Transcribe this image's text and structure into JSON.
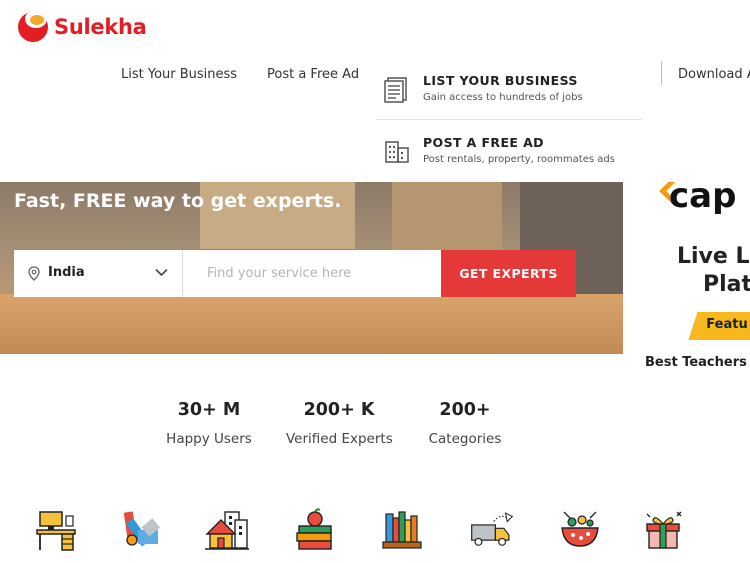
{
  "brand": {
    "name": "Sulekha",
    "accent": "#e21d24",
    "secondary": "#f5a623"
  },
  "nav": {
    "list_business": "List Your Business",
    "post_ad": "Post a Free Ad",
    "download": "Download A"
  },
  "dropdown": [
    {
      "title": "LIST YOUR BUSINESS",
      "subtitle": "Gain access to hundreds of jobs",
      "icon": "document-list-icon"
    },
    {
      "title": "POST A FREE AD",
      "subtitle": "Post rentals, property, roommates ads",
      "icon": "building-icon"
    }
  ],
  "hero": {
    "title": "Fast, FREE way to get experts.",
    "location": "India",
    "search_placeholder": "Find your service here",
    "cta": "GET EXPERTS",
    "cta_color": "#e53838"
  },
  "ad": {
    "logo": "cap",
    "line1": "Live Le",
    "line2": "Plat",
    "badge": "Featu",
    "tagline": "Best Teachers"
  },
  "stats": [
    {
      "value": "30+ M",
      "label": "Happy Users"
    },
    {
      "value": "200+ K",
      "label": "Verified Experts"
    },
    {
      "value": "200+",
      "label": "Categories"
    }
  ],
  "categories": [
    {
      "icon": "office-desk-icon"
    },
    {
      "icon": "paint-swatch-icon"
    },
    {
      "icon": "home-buildings-icon"
    },
    {
      "icon": "books-apple-icon"
    },
    {
      "icon": "bookshelf-icon"
    },
    {
      "icon": "moving-truck-icon"
    },
    {
      "icon": "food-bowl-icon"
    },
    {
      "icon": "gift-box-icon"
    }
  ]
}
